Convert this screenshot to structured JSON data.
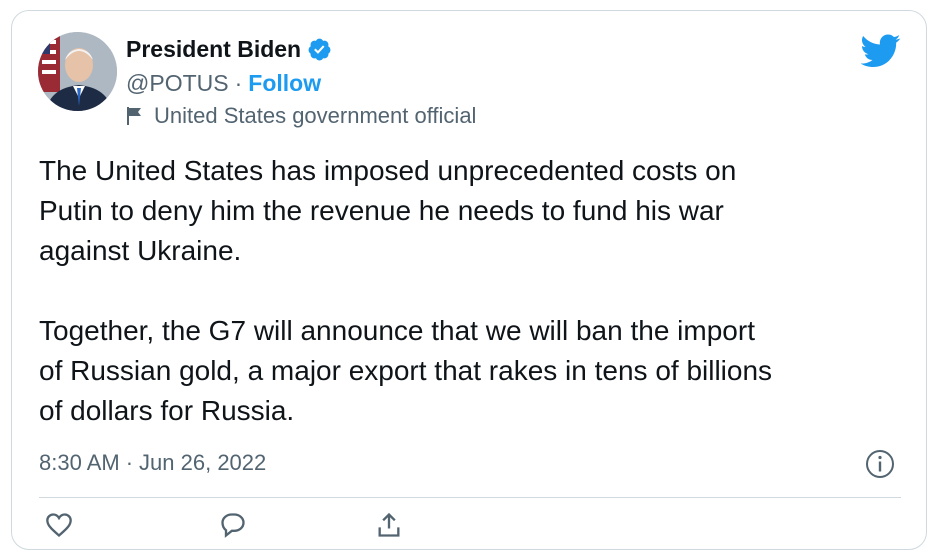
{
  "tweet": {
    "author": {
      "display_name": "President Biden",
      "handle": "@POTUS",
      "separator": "·",
      "follow_label": "Follow",
      "verified": true,
      "account_label": "United States government official"
    },
    "paragraphs": [
      [
        "The United States has imposed unprecedented costs on",
        "Putin to deny him the revenue he needs to fund his war",
        "against Ukraine."
      ],
      [
        "Together, the G7 will announce that we will ban the import",
        "of Russian gold, a major export that rakes in tens of billions",
        "of dollars for Russia."
      ]
    ],
    "time": "8:30 AM",
    "date": "Jun 26, 2022",
    "date_separator": "·"
  },
  "icons": {
    "verified": "verified-badge-icon",
    "twitter": "twitter-bird-icon",
    "flag": "flag-icon",
    "info": "info-icon",
    "like": "heart-icon",
    "reply": "reply-icon",
    "share": "share-icon"
  },
  "colors": {
    "accent": "#1d9bf0",
    "text": "#0f1419",
    "muted": "#536471",
    "border": "#cfd9de"
  }
}
